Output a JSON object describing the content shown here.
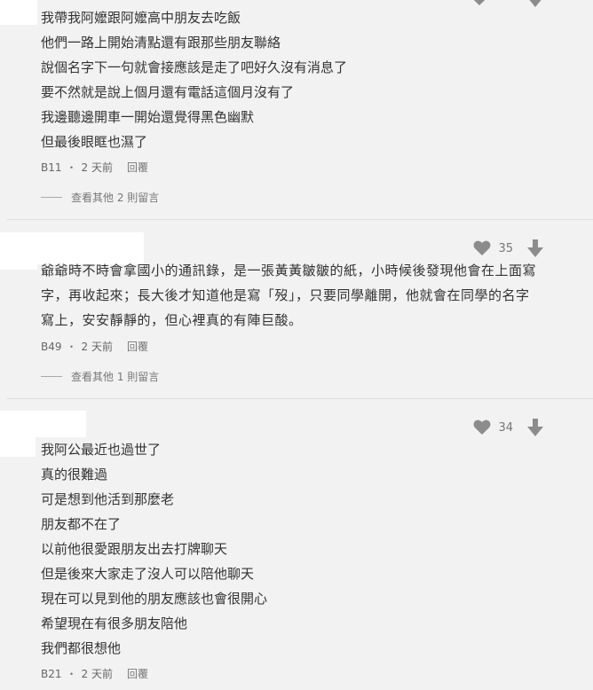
{
  "comments": [
    {
      "lines": [
        "我帶我阿嬤跟阿嬤高中朋友去吃飯",
        "他們一路上開始清點還有跟那些朋友聯絡",
        "說個名字下一句就會接應該是走了吧好久沒有消息了",
        "要不然就是說上個月還有電話這個月沒有了",
        "我邊聽邊開車一開始還覺得黑色幽默",
        "但最後眼眶也濕了"
      ],
      "floor": "B11",
      "time": "2 天前",
      "reply_label": "回覆",
      "more_replies": "查看其他 2 則留言"
    },
    {
      "likes": "35",
      "text": "爺爺時不時會拿國小的通訊錄，是一張黃黃皺皺的紙，小時候後發現他會在上面寫字，再收起來；長大後才知道他是寫「歿」，只要同學離開，他就會在同學的名字寫上，安安靜靜的，但心裡真的有陣巨酸。",
      "floor": "B49",
      "time": "2 天前",
      "reply_label": "回覆",
      "more_replies": "查看其他 1 則留言"
    },
    {
      "likes": "34",
      "lines": [
        "我阿公最近也過世了",
        "真的很難過",
        "可是想到他活到那麼老",
        "朋友都不在了",
        "以前他很愛跟朋友出去打牌聊天",
        "但是後來大家走了沒人可以陪他聊天",
        "現在可以見到他的朋友應該也會很開心",
        "希望現在有很多朋友陪他",
        "我們都很想他"
      ],
      "floor": "B21",
      "time": "2 天前",
      "reply_label": "回覆"
    }
  ],
  "meta_separator": "・",
  "icons": {
    "like": "heart-icon",
    "dislike": "arrow-down-icon"
  },
  "colors": {
    "background": "#f2f2f2",
    "text": "#333333",
    "meta": "#777777",
    "icon": "#8c8c8c"
  }
}
